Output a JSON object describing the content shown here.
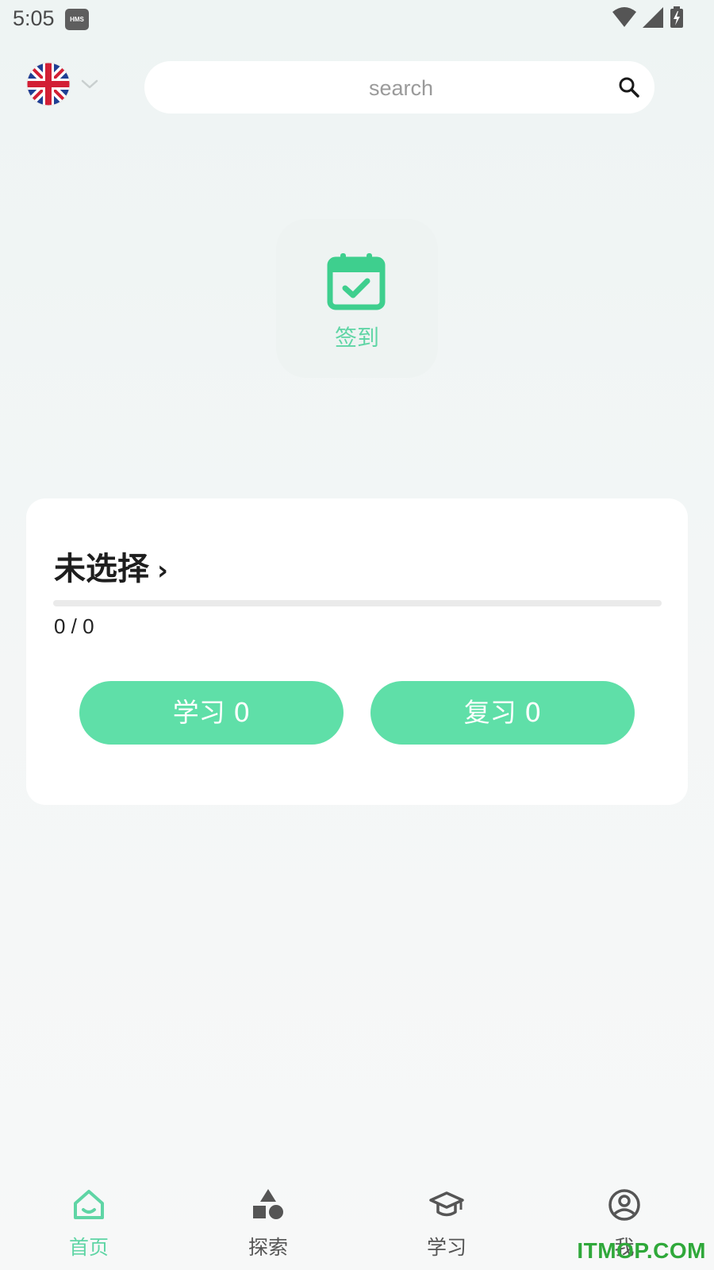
{
  "status_bar": {
    "time": "5:05",
    "hms_badge": "HMS",
    "icons": [
      "wifi-icon",
      "signal-icon",
      "battery-charging-icon"
    ]
  },
  "header": {
    "language_flag": "uk-flag-icon",
    "search": {
      "placeholder": "search",
      "value": ""
    }
  },
  "checkin": {
    "label": "签到",
    "icon": "calendar-check-icon"
  },
  "study_card": {
    "title": "未选择",
    "chevron": "›",
    "progress_text": "0 / 0",
    "progress_fraction": 0,
    "learn_button": "学习 0",
    "review_button": "复习 0"
  },
  "bottom_nav": {
    "items": [
      {
        "label": "首页",
        "icon": "home-icon",
        "active": true
      },
      {
        "label": "探索",
        "icon": "shapes-icon",
        "active": false
      },
      {
        "label": "学习",
        "icon": "graduation-cap-icon",
        "active": false
      },
      {
        "label": "我",
        "icon": "user-circle-icon",
        "active": false
      }
    ]
  },
  "watermark": "ITMOP.COM",
  "colors": {
    "accent": "#5fdfa8",
    "accent_text": "#5fd5a5",
    "background": "#f3f6f6",
    "card": "#ffffff"
  }
}
